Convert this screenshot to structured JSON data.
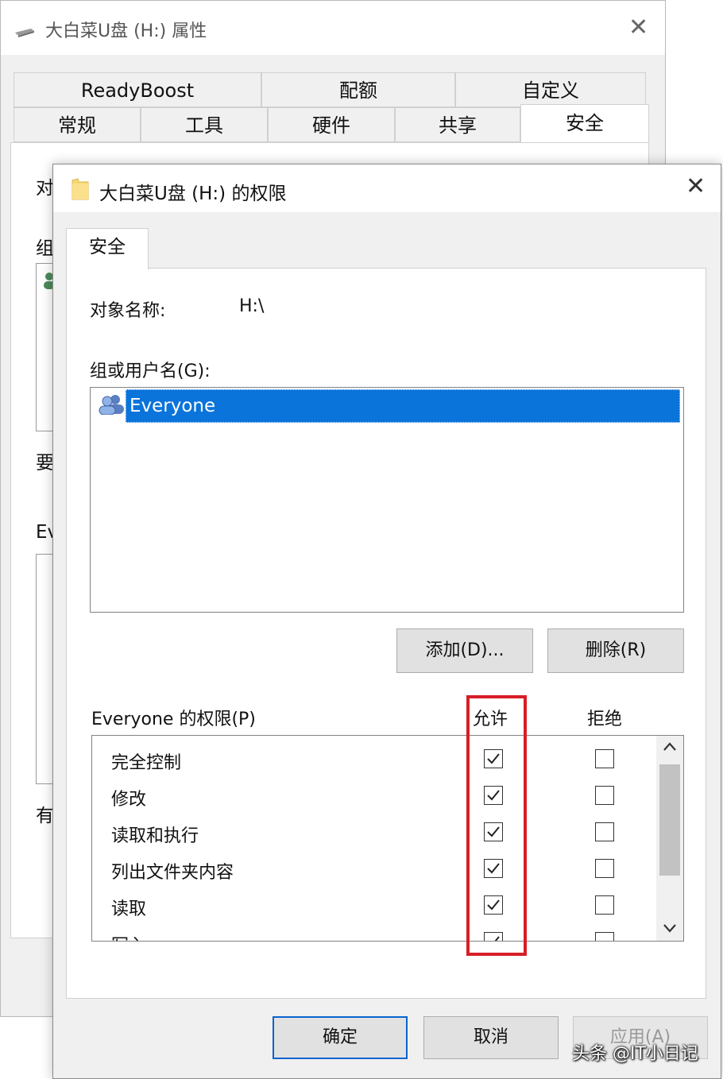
{
  "back_window": {
    "title": "大白菜U盘 (H:) 属性",
    "close_glyph": "✕",
    "tabs_row1": [
      "ReadyBoost",
      "配额",
      "自定义"
    ],
    "tabs_row2": [
      "常规",
      "工具",
      "硬件",
      "共享",
      "安全"
    ],
    "active_tab": "安全",
    "visible_fragments": [
      "对",
      "组",
      "要",
      "Ev",
      "有"
    ]
  },
  "dialog": {
    "title": "大白菜U盘 (H:) 的权限",
    "close_glyph": "✕",
    "tab": "安全",
    "object_name_label": "对象名称:",
    "object_name_value": "H:\\",
    "group_label": "组或用户名(G):",
    "users": [
      {
        "name": "Everyone",
        "selected": true,
        "icon": "users-icon"
      }
    ],
    "add_button": "添加(D)...",
    "remove_button": "删除(R)",
    "permissions_label": "Everyone 的权限(P)",
    "allow_header": "允许",
    "deny_header": "拒绝",
    "permissions": [
      {
        "name": "完全控制",
        "allow": true,
        "deny": false
      },
      {
        "name": "修改",
        "allow": true,
        "deny": false
      },
      {
        "name": "读取和执行",
        "allow": true,
        "deny": false
      },
      {
        "name": "列出文件夹内容",
        "allow": true,
        "deny": false
      },
      {
        "name": "读取",
        "allow": true,
        "deny": false
      },
      {
        "name": "写入",
        "allow": true,
        "deny": false
      }
    ],
    "ok_button": "确定",
    "cancel_button": "取消",
    "apply_button": "应用(A)",
    "apply_disabled": true
  },
  "watermark": "头条 @IT小日记",
  "colors": {
    "selection": "#0a74da",
    "highlight": "#d81e26",
    "dialog_bg": "#f0f0f0"
  }
}
